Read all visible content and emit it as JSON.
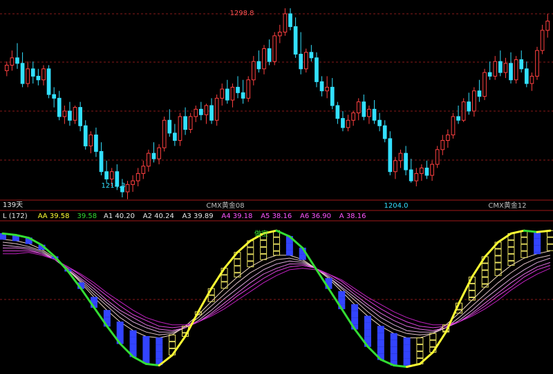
{
  "chart_data": [
    {
      "type": "candlestick",
      "title": "",
      "ylim": [
        1196,
        1302
      ],
      "annotations": {
        "high": {
          "label": "1298.8",
          "value": 1298.8
        },
        "low1": {
          "label": "1214.3",
          "value": 1214.3
        },
        "low2": {
          "label": "1204.0",
          "value": 1204.0
        }
      },
      "period_label": "139天",
      "contract_labels": [
        "CMX黄金08",
        "CMX黄金12"
      ],
      "up_color": "#ff4040",
      "down_color": "#33e0ff",
      "ohlc": [
        [
          1265,
          1270,
          1262,
          1268
        ],
        [
          1268,
          1276,
          1265,
          1272
        ],
        [
          1272,
          1280,
          1266,
          1269
        ],
        [
          1269,
          1275,
          1256,
          1258
        ],
        [
          1258,
          1270,
          1256,
          1266
        ],
        [
          1266,
          1270,
          1258,
          1262
        ],
        [
          1262,
          1266,
          1257,
          1260
        ],
        [
          1260,
          1268,
          1257,
          1266
        ],
        [
          1266,
          1268,
          1250,
          1252
        ],
        [
          1252,
          1256,
          1245,
          1250
        ],
        [
          1250,
          1254,
          1238,
          1240
        ],
        [
          1240,
          1246,
          1236,
          1243
        ],
        [
          1243,
          1248,
          1235,
          1238
        ],
        [
          1238,
          1246,
          1236,
          1245
        ],
        [
          1245,
          1248,
          1232,
          1235
        ],
        [
          1235,
          1238,
          1222,
          1224
        ],
        [
          1224,
          1232,
          1220,
          1230
        ],
        [
          1230,
          1234,
          1218,
          1221
        ],
        [
          1221,
          1226,
          1208,
          1210
        ],
        [
          1210,
          1216,
          1204,
          1206
        ],
        [
          1206,
          1212,
          1202,
          1210
        ],
        [
          1210,
          1214,
          1200,
          1202
        ],
        [
          1202,
          1206,
          1196,
          1199
        ],
        [
          1199,
          1205,
          1195,
          1203
        ],
        [
          1203,
          1208,
          1199,
          1205
        ],
        [
          1205,
          1212,
          1202,
          1209
        ],
        [
          1209,
          1216,
          1206,
          1213
        ],
        [
          1213,
          1222,
          1210,
          1220
        ],
        [
          1220,
          1226,
          1215,
          1217
        ],
        [
          1217,
          1225,
          1214,
          1223
        ],
        [
          1223,
          1240,
          1221,
          1238
        ],
        [
          1238,
          1244,
          1229,
          1231
        ],
        [
          1231,
          1236,
          1224,
          1227
        ],
        [
          1227,
          1242,
          1224,
          1240
        ],
        [
          1240,
          1245,
          1230,
          1233
        ],
        [
          1233,
          1242,
          1231,
          1240
        ],
        [
          1240,
          1246,
          1237,
          1244
        ],
        [
          1244,
          1248,
          1238,
          1241
        ],
        [
          1241,
          1247,
          1236,
          1246
        ],
        [
          1246,
          1250,
          1236,
          1238
        ],
        [
          1238,
          1252,
          1235,
          1250
        ],
        [
          1250,
          1258,
          1246,
          1255
        ],
        [
          1255,
          1260,
          1247,
          1249
        ],
        [
          1249,
          1258,
          1245,
          1256
        ],
        [
          1256,
          1262,
          1250,
          1253
        ],
        [
          1253,
          1260,
          1247,
          1250
        ],
        [
          1250,
          1262,
          1248,
          1260
        ],
        [
          1260,
          1273,
          1257,
          1270
        ],
        [
          1270,
          1276,
          1264,
          1266
        ],
        [
          1266,
          1279,
          1263,
          1277
        ],
        [
          1277,
          1282,
          1268,
          1270
        ],
        [
          1270,
          1286,
          1268,
          1284
        ],
        [
          1284,
          1290,
          1280,
          1286
        ],
        [
          1286,
          1299,
          1284,
          1296
        ],
        [
          1296,
          1299,
          1287,
          1289
        ],
        [
          1289,
          1294,
          1272,
          1274
        ],
        [
          1274,
          1286,
          1263,
          1266
        ],
        [
          1266,
          1277,
          1264,
          1275
        ],
        [
          1275,
          1279,
          1270,
          1272
        ],
        [
          1272,
          1275,
          1256,
          1259
        ],
        [
          1259,
          1262,
          1251,
          1254
        ],
        [
          1254,
          1262,
          1250,
          1256
        ],
        [
          1256,
          1261,
          1244,
          1246
        ],
        [
          1246,
          1248,
          1236,
          1239
        ],
        [
          1239,
          1243,
          1232,
          1234
        ],
        [
          1234,
          1241,
          1232,
          1238
        ],
        [
          1238,
          1243,
          1235,
          1242
        ],
        [
          1242,
          1250,
          1238,
          1248
        ],
        [
          1248,
          1252,
          1238,
          1240
        ],
        [
          1240,
          1246,
          1236,
          1244
        ],
        [
          1244,
          1249,
          1236,
          1238
        ],
        [
          1238,
          1242,
          1232,
          1235
        ],
        [
          1235,
          1238,
          1226,
          1228
        ],
        [
          1228,
          1232,
          1208,
          1210
        ],
        [
          1210,
          1218,
          1206,
          1216
        ],
        [
          1216,
          1222,
          1212,
          1220
        ],
        [
          1220,
          1224,
          1208,
          1211
        ],
        [
          1211,
          1217,
          1204,
          1205
        ],
        [
          1205,
          1212,
          1202,
          1209
        ],
        [
          1209,
          1214,
          1205,
          1212
        ],
        [
          1212,
          1216,
          1206,
          1208
        ],
        [
          1208,
          1216,
          1205,
          1214
        ],
        [
          1214,
          1224,
          1212,
          1222
        ],
        [
          1222,
          1230,
          1219,
          1227
        ],
        [
          1227,
          1233,
          1223,
          1230
        ],
        [
          1230,
          1242,
          1228,
          1240
        ],
        [
          1240,
          1246,
          1236,
          1238
        ],
        [
          1238,
          1250,
          1237,
          1248
        ],
        [
          1248,
          1253,
          1241,
          1243
        ],
        [
          1243,
          1256,
          1240,
          1254
        ],
        [
          1254,
          1260,
          1248,
          1251
        ],
        [
          1251,
          1266,
          1249,
          1264
        ],
        [
          1264,
          1270,
          1260,
          1262
        ],
        [
          1262,
          1273,
          1260,
          1270
        ],
        [
          1270,
          1276,
          1262,
          1264
        ],
        [
          1264,
          1272,
          1261,
          1269
        ],
        [
          1269,
          1275,
          1258,
          1260
        ],
        [
          1260,
          1273,
          1258,
          1271
        ],
        [
          1271,
          1276,
          1264,
          1266
        ],
        [
          1266,
          1270,
          1256,
          1258
        ],
        [
          1258,
          1264,
          1254,
          1262
        ],
        [
          1262,
          1278,
          1260,
          1276
        ],
        [
          1276,
          1290,
          1274,
          1287
        ],
        [
          1287,
          1296,
          1283,
          1292
        ]
      ]
    },
    {
      "type": "line",
      "legend": [
        {
          "label": "L (172)",
          "color": "#e8e8e8"
        },
        {
          "label": "AA 39.58",
          "color": "#ffff33"
        },
        {
          "label": "39.58",
          "color": "#33dd33"
        },
        {
          "label": "A1 40.20",
          "color": "#e8e8e8"
        },
        {
          "label": "A2 40.24",
          "color": "#e8e8e8"
        },
        {
          "label": "A3 39.89",
          "color": "#e8e8e8"
        },
        {
          "label": "A4 39.18",
          "color": "#ff55ff"
        },
        {
          "label": "A5 38.16",
          "color": "#ff55ff"
        },
        {
          "label": "A6 36.90",
          "color": "#ff55ff"
        },
        {
          "label": "A 38.16",
          "color": "#ff55ff"
        }
      ],
      "ylim": [
        0,
        100
      ],
      "annotation": "做空",
      "series": [
        {
          "name": "AA",
          "color": "#ffff33",
          "values": [
            96,
            95,
            93,
            88,
            80,
            70,
            58,
            45,
            32,
            20,
            11,
            6,
            5,
            12,
            25,
            42,
            58,
            72,
            83,
            91,
            96,
            98,
            94,
            86,
            72,
            58,
            44,
            30,
            18,
            9,
            5,
            4,
            6,
            14,
            28,
            48,
            66,
            80,
            90,
            96,
            98,
            97,
            98
          ]
        },
        {
          "name": "",
          "color": "#33dd33",
          "values": [
            null,
            null,
            null,
            null,
            null,
            null,
            null,
            null,
            null,
            null,
            null,
            null,
            null,
            null,
            null,
            null,
            null,
            null,
            null,
            null,
            null,
            null,
            null,
            null,
            null,
            null,
            null,
            null,
            null,
            null,
            null,
            null,
            null,
            null,
            null,
            null,
            null,
            null,
            null,
            null,
            null,
            null,
            null
          ]
        },
        {
          "name": "A1",
          "color": "#f0d8c0",
          "values": [
            92,
            91,
            89,
            85,
            79,
            71,
            62,
            52,
            43,
            35,
            29,
            25,
            24,
            26,
            32,
            40,
            49,
            58,
            66,
            73,
            78,
            81,
            81,
            78,
            72,
            65,
            56,
            47,
            39,
            32,
            27,
            24,
            24,
            27,
            33,
            41,
            50,
            59,
            67,
            74,
            79,
            82,
            84
          ]
        },
        {
          "name": "A2",
          "color": "#e0c0c8",
          "values": [
            90,
            89,
            87,
            84,
            78,
            71,
            63,
            54,
            46,
            38,
            32,
            28,
            26,
            27,
            31,
            38,
            46,
            54,
            62,
            69,
            74,
            78,
            79,
            77,
            72,
            66,
            58,
            50,
            42,
            35,
            30,
            27,
            26,
            27,
            31,
            38,
            46,
            54,
            62,
            69,
            75,
            79,
            81
          ]
        },
        {
          "name": "A3",
          "color": "#d8a8d8",
          "values": [
            88,
            87,
            86,
            83,
            78,
            71,
            64,
            56,
            48,
            41,
            35,
            31,
            28,
            28,
            31,
            36,
            43,
            51,
            58,
            65,
            71,
            75,
            77,
            76,
            72,
            66,
            59,
            52,
            45,
            38,
            33,
            29,
            28,
            28,
            31,
            36,
            43,
            51,
            58,
            65,
            71,
            76,
            79
          ]
        },
        {
          "name": "A4",
          "color": "#e070e0",
          "values": [
            86,
            86,
            85,
            82,
            78,
            72,
            65,
            58,
            50,
            43,
            38,
            33,
            30,
            29,
            31,
            35,
            41,
            48,
            55,
            62,
            68,
            72,
            75,
            75,
            72,
            67,
            61,
            54,
            47,
            41,
            36,
            32,
            30,
            29,
            31,
            35,
            41,
            48,
            55,
            62,
            68,
            73,
            76
          ]
        },
        {
          "name": "A5",
          "color": "#e040e0",
          "values": [
            84,
            84,
            84,
            82,
            78,
            73,
            67,
            60,
            53,
            46,
            40,
            36,
            32,
            31,
            32,
            35,
            40,
            46,
            53,
            59,
            65,
            70,
            73,
            74,
            72,
            68,
            63,
            56,
            50,
            44,
            39,
            35,
            32,
            31,
            32,
            35,
            40,
            46,
            53,
            59,
            66,
            71,
            74
          ]
        },
        {
          "name": "A6",
          "color": "#c020c0",
          "values": [
            82,
            82,
            83,
            81,
            78,
            73,
            68,
            62,
            55,
            49,
            43,
            38,
            35,
            33,
            33,
            35,
            39,
            44,
            50,
            56,
            62,
            67,
            71,
            72,
            71,
            68,
            64,
            58,
            52,
            47,
            42,
            38,
            35,
            33,
            33,
            35,
            39,
            44,
            50,
            57,
            63,
            68,
            72
          ]
        }
      ]
    }
  ]
}
